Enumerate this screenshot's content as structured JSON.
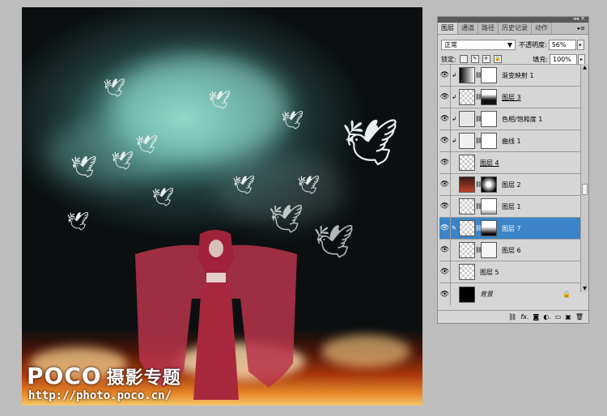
{
  "artwork": {
    "watermark_logo": "POCO",
    "watermark_subtitle": "摄影专题",
    "watermark_url": "http://photo.poco.cn/"
  },
  "panel": {
    "tabs": [
      {
        "label": "图层",
        "active": true
      },
      {
        "label": "通道",
        "active": false
      },
      {
        "label": "路径",
        "active": false
      },
      {
        "label": "历史记录",
        "active": false
      },
      {
        "label": "动作",
        "active": false
      }
    ],
    "blend_mode": "正常",
    "opacity_label": "不透明度:",
    "opacity_value": "56%",
    "lock_label": "锁定:",
    "fill_label": "填充:",
    "fill_value": "100%",
    "layers": [
      {
        "name": "渐变映射 1",
        "selected": false,
        "clipped": true,
        "thumb": "gradient-map-icon"
      },
      {
        "name": "图层 3",
        "selected": false,
        "clipped": true,
        "thumb": "layer-thumb"
      },
      {
        "name": "色相/饱和度 1",
        "selected": false,
        "clipped": true,
        "thumb": "hue-saturation-icon"
      },
      {
        "name": "曲线 1",
        "selected": false,
        "clipped": true,
        "thumb": "curves-icon"
      },
      {
        "name": "图层 4",
        "selected": false,
        "clipped": false,
        "thumb": "layer-thumb"
      },
      {
        "name": "图层 2",
        "selected": false,
        "clipped": false,
        "thumb": "layer-thumb"
      },
      {
        "name": "图层 1",
        "selected": false,
        "clipped": false,
        "thumb": "layer-thumb"
      },
      {
        "name": "图层 7",
        "selected": true,
        "clipped": false,
        "thumb": "layer-thumb"
      },
      {
        "name": "图层 6",
        "selected": false,
        "clipped": false,
        "thumb": "layer-thumb"
      },
      {
        "name": "图层 5",
        "selected": false,
        "clipped": false,
        "thumb": "layer-thumb"
      },
      {
        "name": "背景",
        "selected": false,
        "clipped": false,
        "thumb": "layer-thumb",
        "locked": true
      }
    ],
    "bottom_icons": [
      "link-icon",
      "fx-icon",
      "mask-icon",
      "adjustment-icon",
      "folder-icon",
      "new-layer-icon",
      "trash-icon"
    ],
    "colors": {
      "selected": "#3b84c7",
      "panel_bg": "#d6d6d6"
    }
  }
}
